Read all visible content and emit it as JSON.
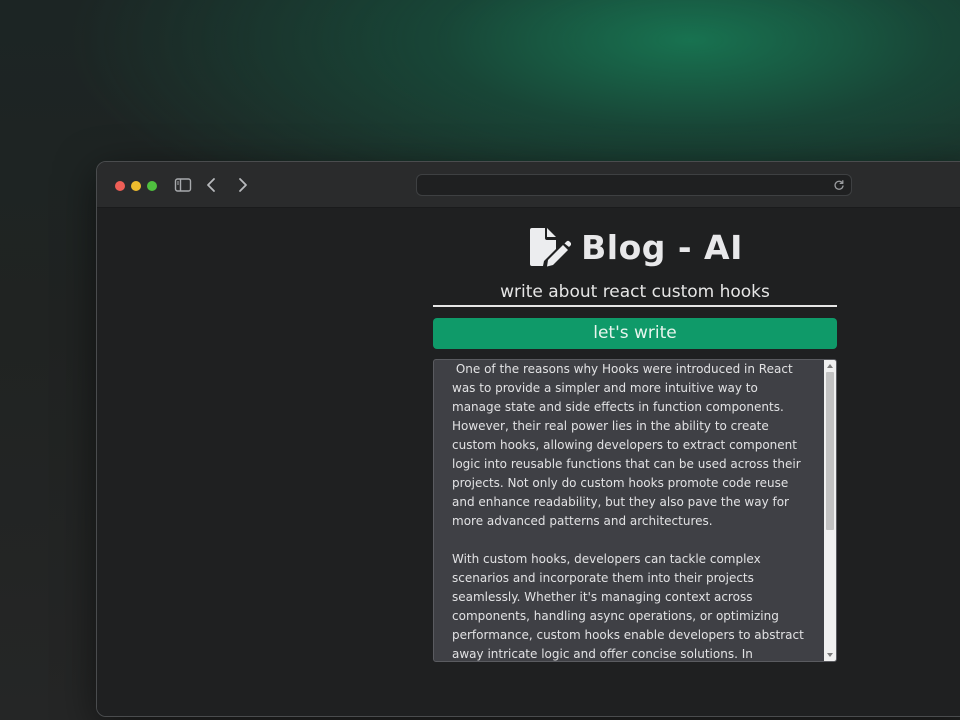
{
  "browser": {
    "url": "",
    "icons": [
      "sidebar-icon",
      "chevron-left-icon",
      "chevron-right-icon",
      "reload-icon"
    ]
  },
  "app": {
    "title": "Blog - AI",
    "logo_icon": "file-pen-icon",
    "prompt_value": "write about react custom hooks",
    "button_label": "let's write",
    "output_text": " One of the reasons why Hooks were introduced in React was to provide a simpler and more intuitive way to manage state and side effects in function components. However, their real power lies in the ability to create custom hooks, allowing developers to extract component logic into reusable functions that can be used across their projects. Not only do custom hooks promote code reuse and enhance readability, but they also pave the way for more advanced patterns and architectures.\n\nWith custom hooks, developers can tackle complex scenarios and incorporate them into their projects seamlessly. Whether it's managing context across components, handling async operations, or optimizing performance, custom hooks enable developers to abstract away intricate logic and offer concise solutions. In addition, custom hooks can serve as a means to establish consistent conventions and patterns within a team or"
  },
  "colors": {
    "accent": "#0f9a69",
    "background": "#1f2021",
    "output_bg": "#3f4045",
    "text": "#e8e8ea"
  }
}
